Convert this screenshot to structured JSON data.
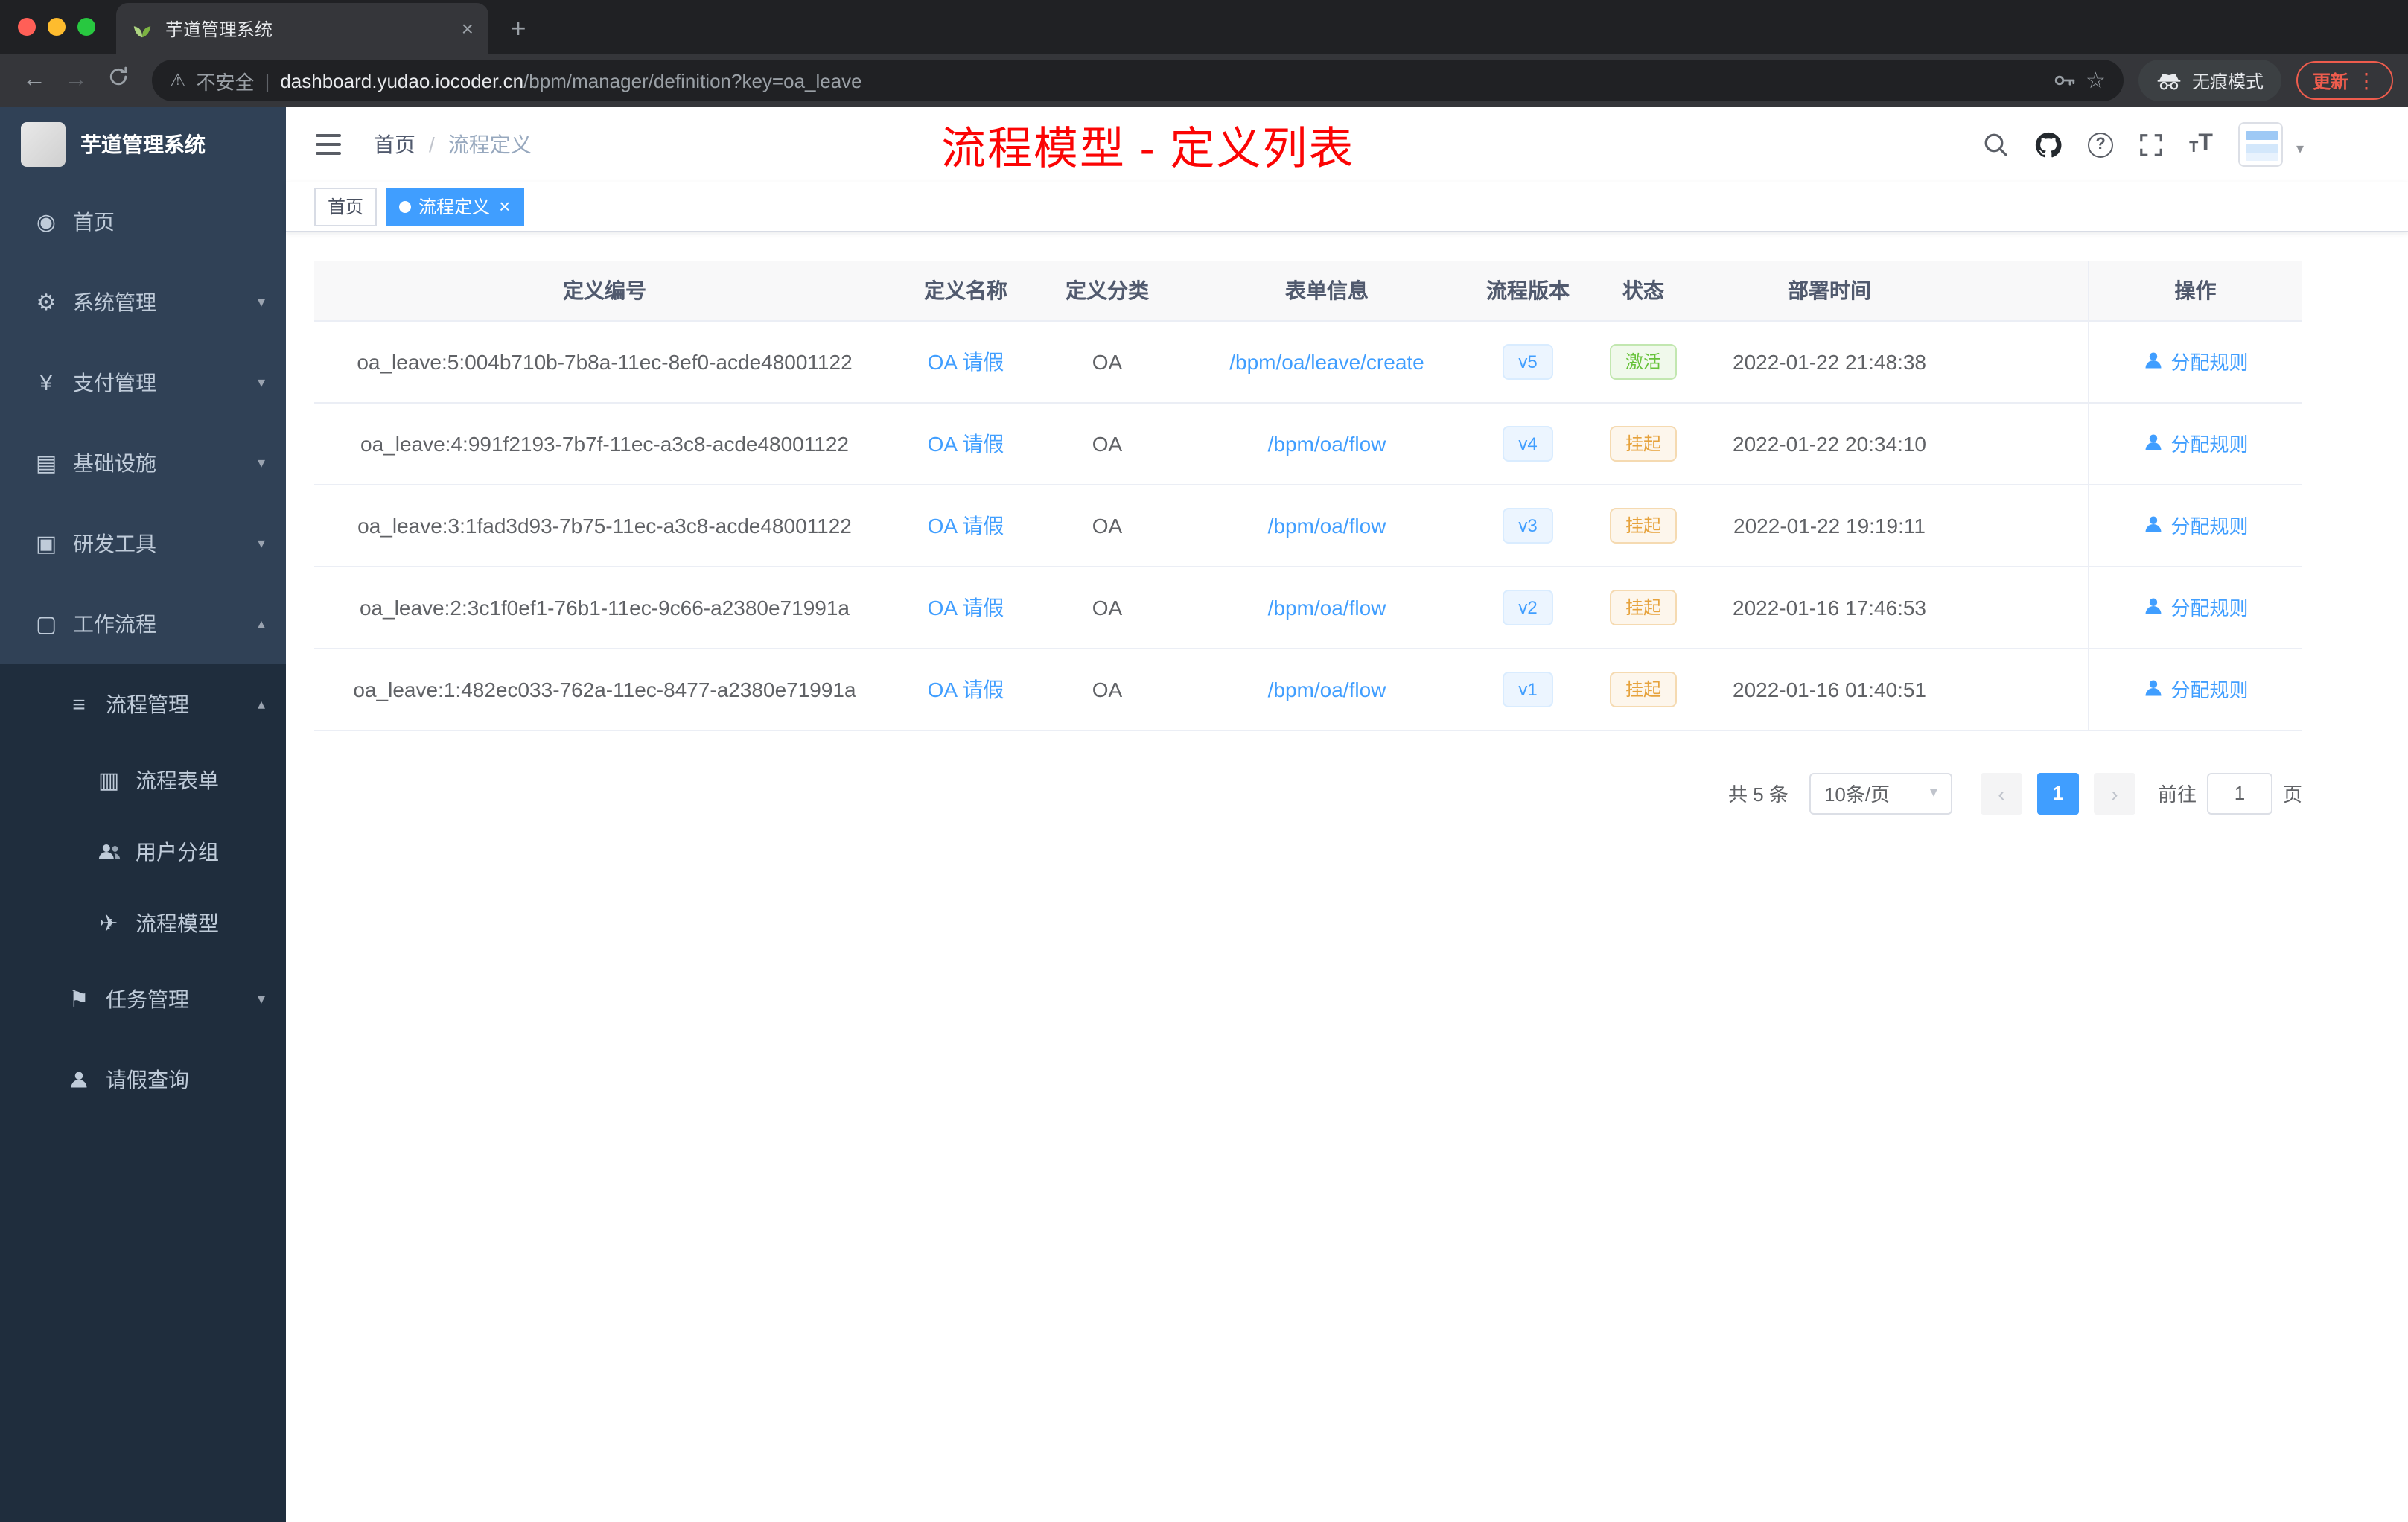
{
  "colors": {
    "accent": "#409eff",
    "annotation_red": "#fb0404",
    "success_green": "#67c23a",
    "warning_orange": "#e6a23c",
    "sidebar_bg": "#304156",
    "sidebar_sub_bg": "#1f2d3d",
    "chrome_dark": "#202124"
  },
  "browser": {
    "tab_title": "芋道管理系统",
    "security_label": "不安全",
    "url_domain": "dashboard.yudao.iocoder.cn",
    "url_path": "/bpm/manager/definition?key=oa_leave",
    "incognito_label": "无痕模式",
    "update_label": "更新"
  },
  "sidebar": {
    "logo_title": "芋道管理系统",
    "items": [
      {
        "name": "home",
        "label": "首页",
        "icon": "dashboard",
        "level": 1
      },
      {
        "name": "system-management",
        "label": "系统管理",
        "icon": "gear",
        "level": 1,
        "chevron": "down"
      },
      {
        "name": "payment-management",
        "label": "支付管理",
        "icon": "yen",
        "level": 1,
        "chevron": "down"
      },
      {
        "name": "infrastructure",
        "label": "基础设施",
        "icon": "monitor",
        "level": 1,
        "chevron": "down"
      },
      {
        "name": "dev-tools",
        "label": "研发工具",
        "icon": "toolbox",
        "level": 1,
        "chevron": "down"
      },
      {
        "name": "workflow",
        "label": "工作流程",
        "icon": "briefcase",
        "level": 1,
        "chevron": "up"
      },
      {
        "name": "process-management",
        "label": "流程管理",
        "icon": "list",
        "level": 2,
        "chevron": "up"
      },
      {
        "name": "process-form",
        "label": "流程表单",
        "icon": "form",
        "level": 3
      },
      {
        "name": "user-group",
        "label": "用户分组",
        "icon": "users",
        "level": 3
      },
      {
        "name": "process-model",
        "label": "流程模型",
        "icon": "paper-plane",
        "level": 3
      },
      {
        "name": "task-management",
        "label": "任务管理",
        "icon": "flag",
        "level": 2,
        "chevron": "down"
      },
      {
        "name": "leave-query",
        "label": "请假查询",
        "icon": "person",
        "level": 2
      }
    ]
  },
  "header": {
    "breadcrumb": {
      "home": "首页",
      "separator": "/",
      "current": "流程定义"
    },
    "annotation": "流程模型 - 定义列表"
  },
  "tags": [
    {
      "label": "首页",
      "active": false
    },
    {
      "label": "流程定义",
      "active": true
    }
  ],
  "table": {
    "columns": [
      "定义编号",
      "定义名称",
      "定义分类",
      "表单信息",
      "流程版本",
      "状态",
      "部署时间",
      "操作"
    ],
    "rows": [
      {
        "id": "oa_leave:5:004b710b-7b8a-11ec-8ef0-acde48001122",
        "name": "OA 请假",
        "category": "OA",
        "form": "/bpm/oa/leave/create",
        "version": "v5",
        "status": "激活",
        "status_type": "success",
        "time": "2022-01-22 21:48:38",
        "action": "分配规则"
      },
      {
        "id": "oa_leave:4:991f2193-7b7f-11ec-a3c8-acde48001122",
        "name": "OA 请假",
        "category": "OA",
        "form": "/bpm/oa/flow",
        "version": "v4",
        "status": "挂起",
        "status_type": "warning",
        "time": "2022-01-22 20:34:10",
        "action": "分配规则"
      },
      {
        "id": "oa_leave:3:1fad3d93-7b75-11ec-a3c8-acde48001122",
        "name": "OA 请假",
        "category": "OA",
        "form": "/bpm/oa/flow",
        "version": "v3",
        "status": "挂起",
        "status_type": "warning",
        "time": "2022-01-22 19:19:11",
        "action": "分配规则"
      },
      {
        "id": "oa_leave:2:3c1f0ef1-76b1-11ec-9c66-a2380e71991a",
        "name": "OA 请假",
        "category": "OA",
        "form": "/bpm/oa/flow",
        "version": "v2",
        "status": "挂起",
        "status_type": "warning",
        "time": "2022-01-16 17:46:53",
        "action": "分配规则"
      },
      {
        "id": "oa_leave:1:482ec033-762a-11ec-8477-a2380e71991a",
        "name": "OA 请假",
        "category": "OA",
        "form": "/bpm/oa/flow",
        "version": "v1",
        "status": "挂起",
        "status_type": "warning",
        "time": "2022-01-16 01:40:51",
        "action": "分配规则"
      }
    ]
  },
  "pagination": {
    "total": "共 5 条",
    "page_size": "10条/页",
    "current_page": "1",
    "goto_label": "前往",
    "goto_value": "1",
    "page_unit": "页"
  },
  "icons": {
    "warning": "⚠",
    "pipe": "|",
    "star": "☆",
    "back": "←",
    "forward": "→",
    "close": "×",
    "plus": "+",
    "dots": "⋮",
    "caret-down": "▾",
    "chevron-down": "▾",
    "chevron-up": "▴",
    "question": "?",
    "font-size": "T",
    "font-size-small": "T",
    "prev": "‹",
    "next": "›",
    "dashboard": "◉",
    "gear": "⚙",
    "yen": "¥",
    "monitor": "▤",
    "toolbox": "▣",
    "briefcase": "▢",
    "list": "≡",
    "form": "▥",
    "paper-plane": "✈",
    "flag": "⚑"
  }
}
